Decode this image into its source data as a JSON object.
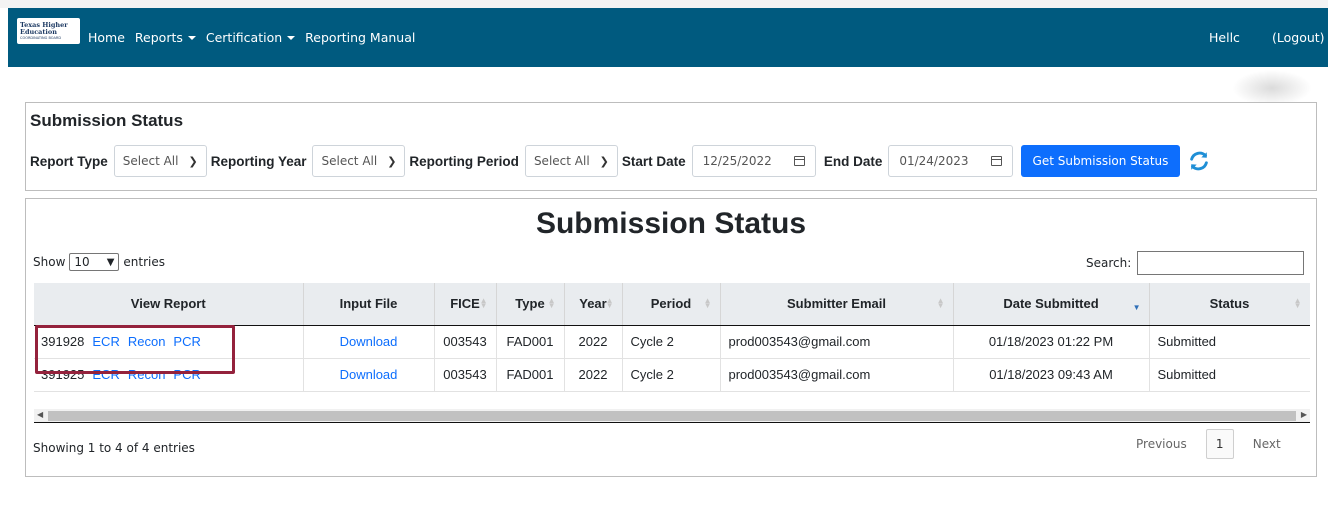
{
  "navbar": {
    "logo_line1": "Texas Higher",
    "logo_line2": "Education",
    "logo_line3": "COORDINATING BOARD",
    "links": [
      "Home",
      "Reports",
      "Certification",
      "Reporting Manual"
    ],
    "user": "Hellc",
    "logout": "(Logout)",
    "color": "#005a7f"
  },
  "filter_panel": {
    "title": "Submission Status",
    "report_type_label": "Report Type",
    "report_type_value": "Select All",
    "reporting_year_label": "Reporting Year",
    "reporting_year_value": "Select All",
    "reporting_period_label": "Reporting Period",
    "reporting_period_value": "Select All",
    "start_date_label": "Start Date",
    "start_date_value": "12/25/2022",
    "end_date_label": "End Date",
    "end_date_value": "01/24/2023",
    "submit_button": "Get Submission Status"
  },
  "results": {
    "title": "Submission Status",
    "show_label": "Show",
    "entries_value": "10",
    "entries_label": "entries",
    "search_label": "Search:",
    "columns": [
      "View Report",
      "Input File",
      "FICE",
      "Type",
      "Year",
      "Period",
      "Submitter Email",
      "Date Submitted",
      "Status"
    ],
    "rows": [
      {
        "id": "391928",
        "links": [
          "ECR",
          "Recon",
          "PCR"
        ],
        "input_file": "Download",
        "fice": "003543",
        "type": "FAD001",
        "year": "2022",
        "period": "Cycle 2",
        "email": "prod003543@gmail.com",
        "date": "01/18/2023 01:22 PM",
        "status": "Submitted"
      },
      {
        "id": "391925",
        "links": [
          "ECR",
          "Recon",
          "PCR"
        ],
        "input_file": "Download",
        "fice": "003543",
        "type": "FAD001",
        "year": "2022",
        "period": "Cycle 2",
        "email": "prod003543@gmail.com",
        "date": "01/18/2023 09:43 AM",
        "status": "Submitted"
      }
    ],
    "info": "Showing 1 to 4 of 4 entries",
    "previous": "Previous",
    "current_page": "1",
    "next": "Next"
  },
  "colors": {
    "link": "#0d6efd",
    "button": "#0d6efd",
    "highlight": "#94223c"
  }
}
